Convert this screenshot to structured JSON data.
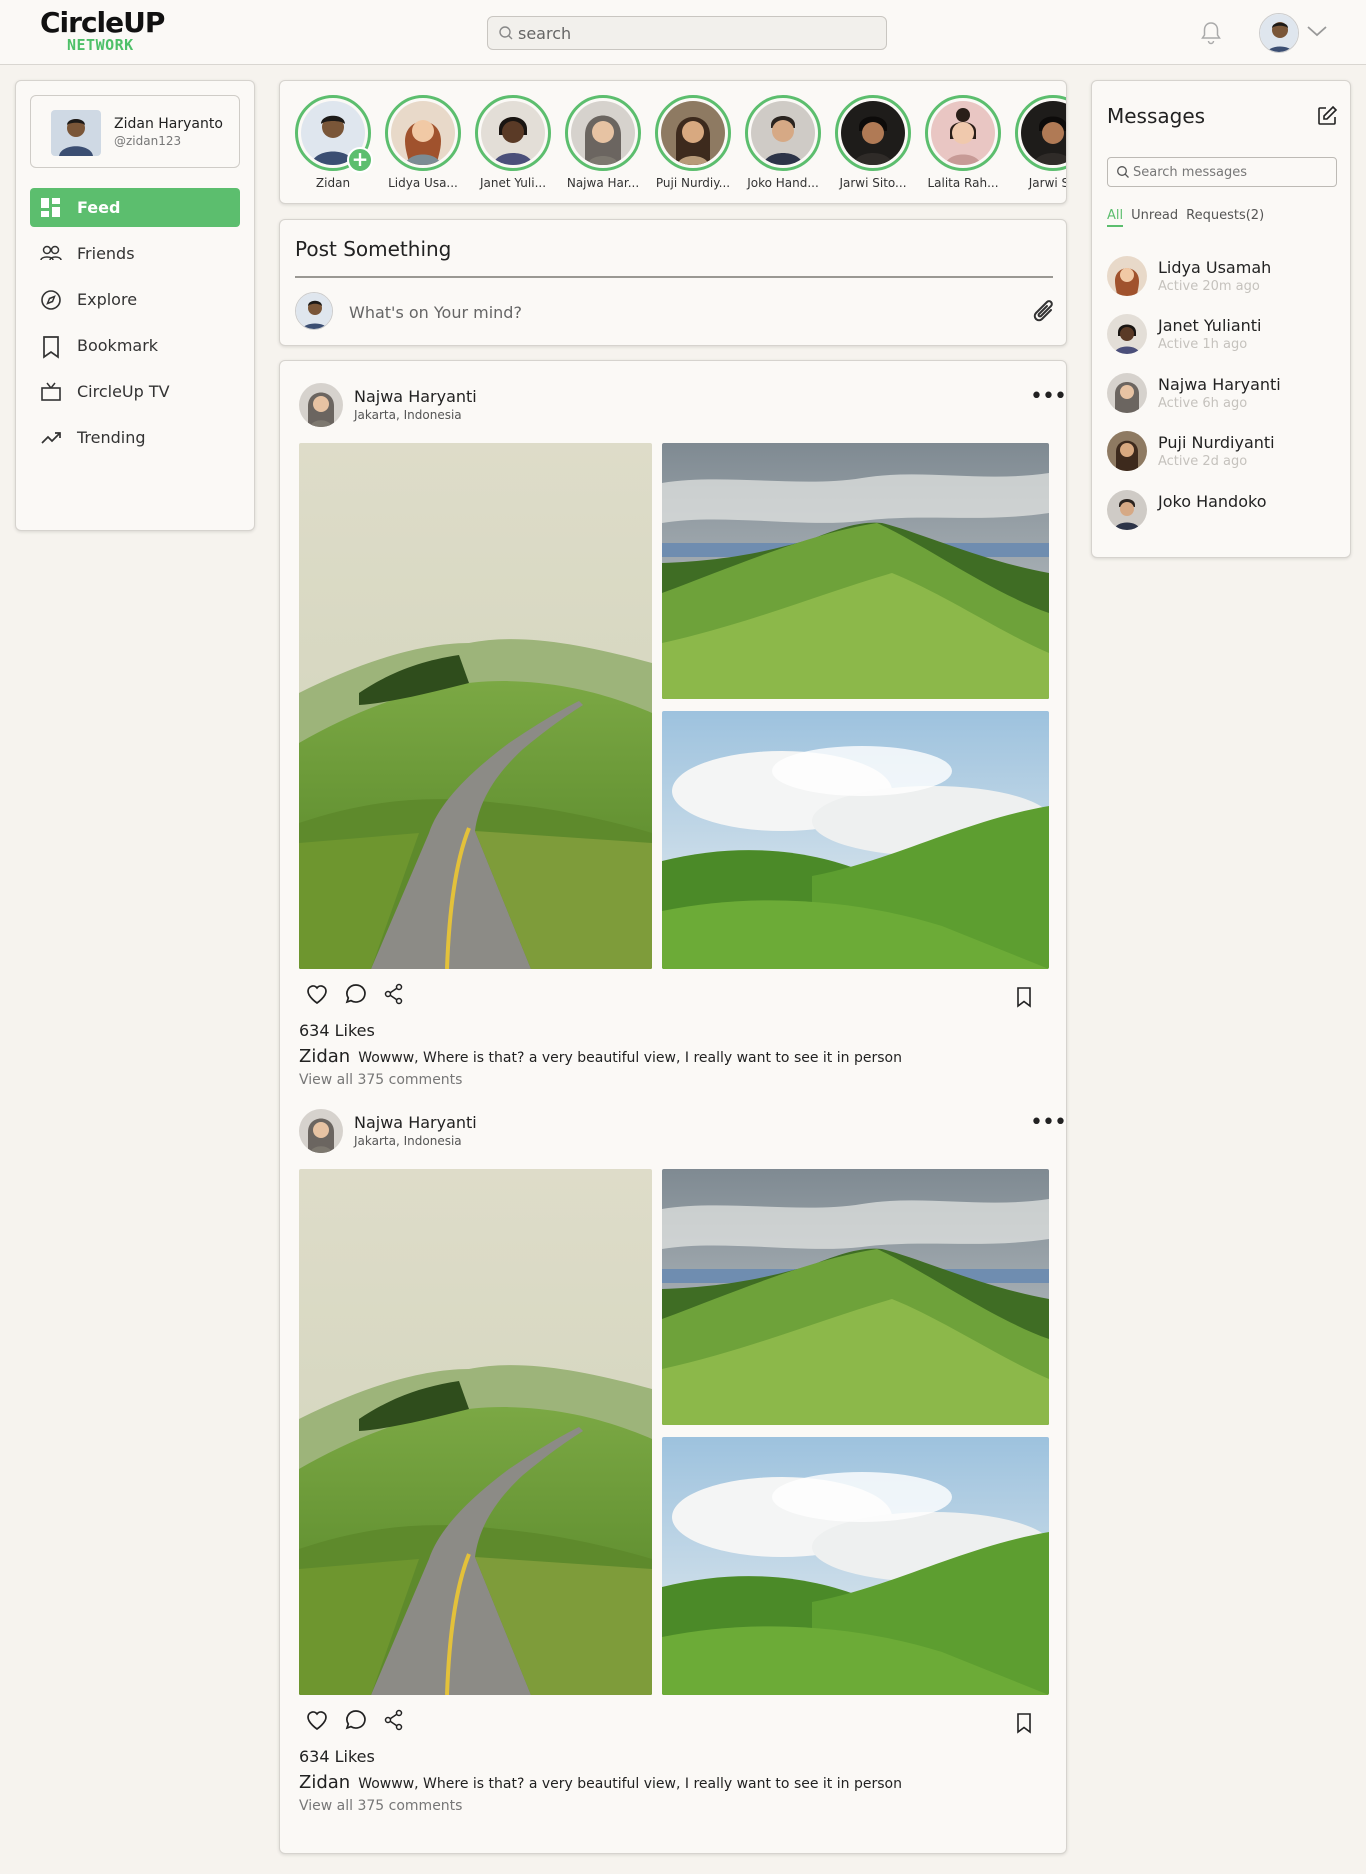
{
  "header": {
    "logo_top": "CircleUP",
    "logo_bottom": "NETWORK",
    "search_placeholder": "search"
  },
  "profile": {
    "name": "Zidan Haryanto",
    "handle": "@zidan123"
  },
  "nav": [
    {
      "label": "Feed",
      "icon": "grid-icon",
      "active": true
    },
    {
      "label": "Friends",
      "icon": "users-icon"
    },
    {
      "label": "Explore",
      "icon": "compass-icon"
    },
    {
      "label": "Bookmark",
      "icon": "bookmark-icon"
    },
    {
      "label": "CircleUp TV",
      "icon": "tv-icon"
    },
    {
      "label": "Trending",
      "icon": "trending-icon"
    }
  ],
  "stories": [
    {
      "name": "Zidan",
      "add_icon": "plus-icon"
    },
    {
      "name": "Lidya Usa..."
    },
    {
      "name": "Janet Yuli..."
    },
    {
      "name": "Najwa Har..."
    },
    {
      "name": "Puji Nurdiy..."
    },
    {
      "name": "Joko Hand..."
    },
    {
      "name": "Jarwi Sito..."
    },
    {
      "name": "Lalita Rah..."
    },
    {
      "name": "Jarwi Sit"
    }
  ],
  "composer": {
    "title": "Post Something",
    "placeholder": "What's on Your mind?"
  },
  "posts": [
    {
      "author": "Najwa Haryanti",
      "location": "Jakarta, Indonesia",
      "likes": "634 Likes",
      "caption_user": "Zidan",
      "caption": "Wowww, Where is that? a very beautiful view, I really want to see it in person",
      "view_comments": "View all 375 comments"
    },
    {
      "author": "Najwa Haryanti",
      "location": "Jakarta, Indonesia",
      "likes": "634 Likes",
      "caption_user": "Zidan",
      "caption": "Wowww, Where is that? a very beautiful view, I really want to see it in person",
      "view_comments": "View all 375 comments"
    }
  ],
  "messages": {
    "title": "Messages",
    "search_placeholder": "Search messages",
    "tabs": [
      "All",
      "Unread",
      "Requests(2)"
    ],
    "contacts": [
      {
        "name": "Lidya Usamah",
        "active": "Active 20m ago"
      },
      {
        "name": "Janet Yulianti",
        "active": "Active 1h ago"
      },
      {
        "name": "Najwa Haryanti",
        "active": "Active 6h ago"
      },
      {
        "name": "Puji Nurdiyanti",
        "active": "Active 2d ago"
      },
      {
        "name": "Joko Handoko",
        "active": ""
      }
    ]
  },
  "colors": {
    "accent": "#5cbe6e",
    "background": "#f6f3ee",
    "card": "#fbf9f6"
  }
}
